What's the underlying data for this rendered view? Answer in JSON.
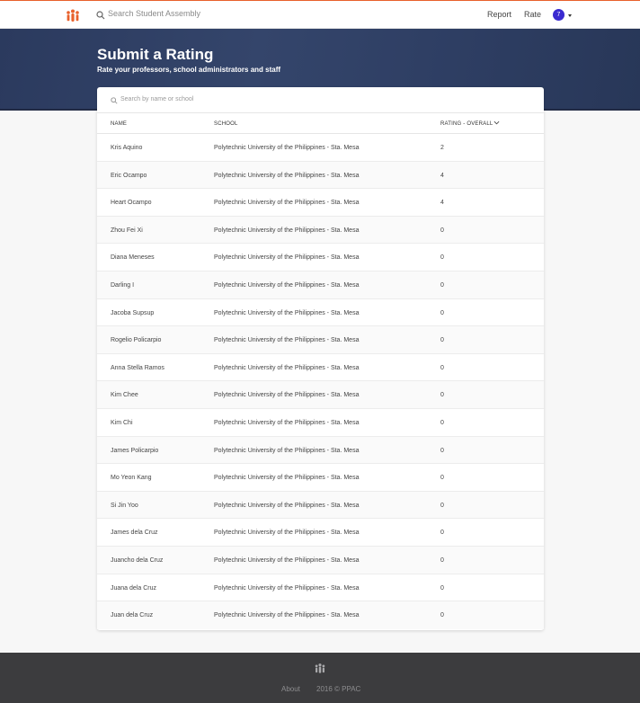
{
  "topbar": {
    "search_placeholder": "Search Student Assembly",
    "nav_report": "Report",
    "nav_rate": "Rate",
    "notification_count": "7",
    "logo_icon": "people-group-icon",
    "accent_color": "#e8612c",
    "badge_color": "#3a2ad0"
  },
  "hero": {
    "title": "Submit a Rating",
    "subtitle": "Rate your professors, school administrators and staff"
  },
  "table": {
    "search_placeholder": "Search by name or school",
    "columns": {
      "name": "NAME",
      "school": "SCHOOL",
      "rating": "RATING - OVERALL"
    },
    "rows": [
      {
        "name": "Kris Aquino",
        "school": "Polytechnic University of the Philippines - Sta. Mesa",
        "rating": "2"
      },
      {
        "name": "Eric Ocampo",
        "school": "Polytechnic University of the Philippines - Sta. Mesa",
        "rating": "4"
      },
      {
        "name": "Heart Ocampo",
        "school": "Polytechnic University of the Philippines - Sta. Mesa",
        "rating": "4"
      },
      {
        "name": "Zhou Fei Xi",
        "school": "Polytechnic University of the Philippines - Sta. Mesa",
        "rating": "0"
      },
      {
        "name": "Diana Meneses",
        "school": "Polytechnic University of the Philippines - Sta. Mesa",
        "rating": "0"
      },
      {
        "name": "Darling I",
        "school": "Polytechnic University of the Philippines - Sta. Mesa",
        "rating": "0"
      },
      {
        "name": "Jacoba Supsup",
        "school": "Polytechnic University of the Philippines - Sta. Mesa",
        "rating": "0"
      },
      {
        "name": "Rogelio Policarpio",
        "school": "Polytechnic University of the Philippines - Sta. Mesa",
        "rating": "0"
      },
      {
        "name": "Anna Stella Ramos",
        "school": "Polytechnic University of the Philippines - Sta. Mesa",
        "rating": "0"
      },
      {
        "name": "Kim Chee",
        "school": "Polytechnic University of the Philippines - Sta. Mesa",
        "rating": "0"
      },
      {
        "name": "Kim Chi",
        "school": "Polytechnic University of the Philippines - Sta. Mesa",
        "rating": "0"
      },
      {
        "name": "James Policarpio",
        "school": "Polytechnic University of the Philippines - Sta. Mesa",
        "rating": "0"
      },
      {
        "name": "Mo Yeon Kang",
        "school": "Polytechnic University of the Philippines - Sta. Mesa",
        "rating": "0"
      },
      {
        "name": "Si Jin Yoo",
        "school": "Polytechnic University of the Philippines - Sta. Mesa",
        "rating": "0"
      },
      {
        "name": "James dela Cruz",
        "school": "Polytechnic University of the Philippines - Sta. Mesa",
        "rating": "0"
      },
      {
        "name": "Juancho dela Cruz",
        "school": "Polytechnic University of the Philippines - Sta. Mesa",
        "rating": "0"
      },
      {
        "name": "Juana dela Cruz",
        "school": "Polytechnic University of the Philippines - Sta. Mesa",
        "rating": "0"
      },
      {
        "name": "Juan dela Cruz",
        "school": "Polytechnic University of the Philippines - Sta. Mesa",
        "rating": "0"
      }
    ]
  },
  "footer": {
    "about": "About",
    "copyright": "2016 © PPAC",
    "logo_icon": "people-group-icon"
  }
}
